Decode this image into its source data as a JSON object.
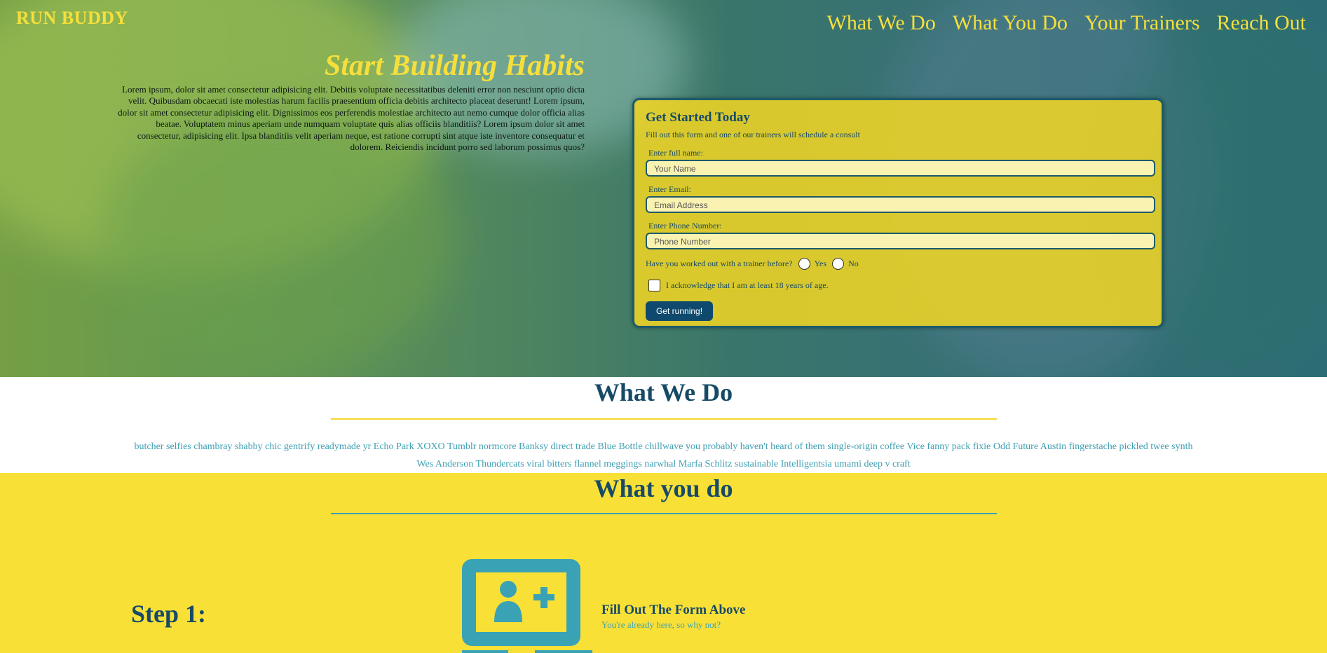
{
  "brand": "RUN BUDDY",
  "nav": [
    "What We Do",
    "What You Do",
    "Your Trainers",
    "Reach Out"
  ],
  "hero": {
    "title": "Start Building Habits",
    "text": "Lorem ipsum, dolor sit amet consectetur adipisicing elit. Debitis voluptate necessitatibus deleniti error non nesciunt optio dicta velit. Quibusdam obcaecati iste molestias harum facilis praesentium officia debitis architecto placeat deserunt! Lorem ipsum, dolor sit amet consectetur adipisicing elit. Dignissimos eos perferendis molestiae architecto aut nemo cumque dolor officia alias beatae. Voluptatem minus aperiam unde numquam voluptate quis alias officiis blanditiis? Lorem ipsum dolor sit amet consectetur, adipisicing elit. Ipsa blanditiis velit aperiam neque, est ratione corrupti sint atque iste inventore consequatur et dolorem. Reiciendis incidunt porro sed laborum possimus quos?"
  },
  "form": {
    "title": "Get Started Today",
    "subtitle": "Fill out this form and one of our trainers will schedule a consult",
    "name_label": "Enter full name:",
    "name_placeholder": "Your Name",
    "email_label": "Enter Email:",
    "email_placeholder": "Email Address",
    "phone_label": "Enter Phone Number:",
    "phone_placeholder": "Phone Number",
    "trainer_question": "Have you worked out with a trainer before?",
    "yes": "Yes",
    "no": "No",
    "age_ack": "I acknowledge that I am at least 18 years of age.",
    "submit": "Get running!"
  },
  "what_we_do": {
    "title": "What We Do",
    "text": "butcher selfies chambray shabby chic gentrify readymade yr Echo Park XOXO Tumblr normcore Banksy direct trade Blue Bottle chillwave you probably haven't heard of them single-origin coffee Vice fanny pack fixie Odd Future Austin fingerstache pickled twee synth Wes Anderson Thundercats viral bitters flannel meggings narwhal Marfa Schlitz sustainable Intelligentsia umami deep v craft"
  },
  "what_you_do": {
    "title": "What you do",
    "step_label": "Step 1:",
    "step_icon": "add-user-icon",
    "step_title": "Fill Out The Form Above",
    "step_sub": "You're already here, so why not?"
  },
  "colors": {
    "yellow": "#f9e036",
    "navy": "#164a66",
    "teal": "#3aa2b5"
  }
}
